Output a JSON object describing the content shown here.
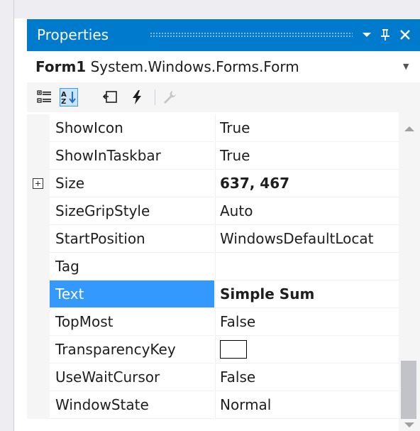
{
  "panel": {
    "title": "Properties",
    "buttons": {
      "dropdown": "▼",
      "pin": "ᵖ",
      "close": "✕"
    }
  },
  "object_selector": {
    "name": "Form1",
    "type": "System.Windows.Forms.Form"
  },
  "toolbar": {
    "tools": [
      {
        "icon": "categorized-icon",
        "active": false
      },
      {
        "icon": "alphabetical-sort-icon",
        "active": true
      },
      {
        "icon": "properties-page-icon",
        "active": false
      },
      {
        "icon": "events-lightning-icon",
        "active": false
      },
      {
        "icon": "property-pages-wrench-icon",
        "active": false
      }
    ]
  },
  "properties": [
    {
      "name": "ShowIcon",
      "value": "True",
      "bold": false,
      "expandable": false
    },
    {
      "name": "ShowInTaskbar",
      "value": "True",
      "bold": false,
      "expandable": false
    },
    {
      "name": "Size",
      "value": "637, 467",
      "bold": true,
      "expandable": true
    },
    {
      "name": "SizeGripStyle",
      "value": "Auto",
      "bold": false,
      "expandable": false
    },
    {
      "name": "StartPosition",
      "value": "WindowsDefaultLocat",
      "bold": false,
      "expandable": false
    },
    {
      "name": "Tag",
      "value": "",
      "bold": false,
      "expandable": false
    },
    {
      "name": "Text",
      "value": "Simple Sum",
      "bold": true,
      "expandable": false,
      "selected": true
    },
    {
      "name": "TopMost",
      "value": "False",
      "bold": false,
      "expandable": false
    },
    {
      "name": "TransparencyKey",
      "value": "",
      "bold": false,
      "expandable": false,
      "swatch_color": "#ffffff"
    },
    {
      "name": "UseWaitCursor",
      "value": "False",
      "bold": false,
      "expandable": false
    },
    {
      "name": "WindowState",
      "value": "Normal",
      "bold": false,
      "expandable": false
    }
  ],
  "colors": {
    "titlebar": "#007acc",
    "selection": "#3399ff"
  }
}
